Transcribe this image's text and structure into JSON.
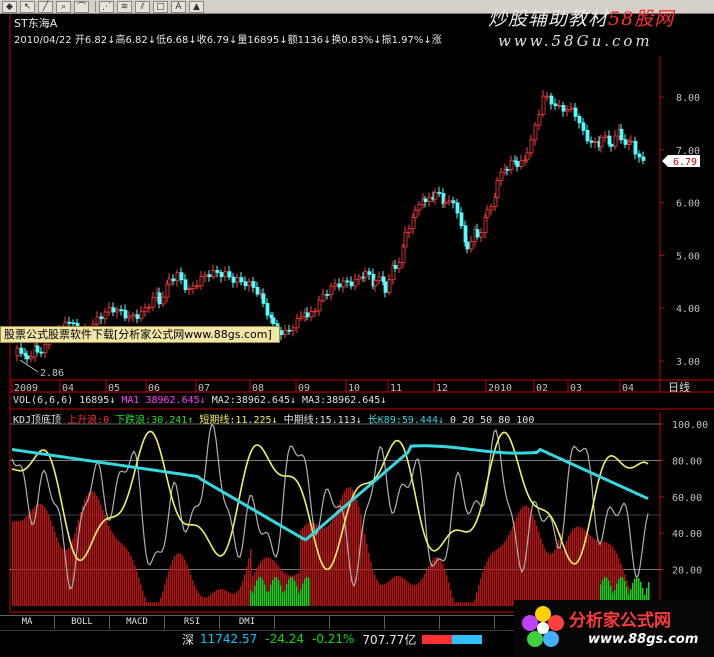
{
  "toolbar": {
    "buttons": [
      "diamond-icon",
      "cursor-icon",
      "line-draw-icon",
      "zoom-icon",
      "trend-icon",
      "pattern-icon",
      "square-icon",
      "text-icon",
      "arrow-up-icon"
    ]
  },
  "stock": {
    "name": "ST东海A",
    "date": "2010/04/22",
    "quote": "开6.82↓高6.82↓低6.68↓收6.79↓量16895↓额1136↓换0.83%↓振1.97%↓涨"
  },
  "watermark": {
    "title": "炒股辅助教材",
    "brand": "58股网",
    "url": "www.58Gu.com"
  },
  "price_chart": {
    "y_ticks": [
      "8.00",
      "7.00",
      "6.00",
      "5.00",
      "4.00",
      "3.00"
    ],
    "current_price": "6.79",
    "low_marker": "2.86",
    "x_labels": [
      "2009",
      "04",
      "05",
      "06",
      "07",
      "08",
      "09",
      "10",
      "11",
      "12",
      "2010",
      "02",
      "03",
      "04"
    ],
    "period": "日线"
  },
  "promo_banner": "股票公式股票软件下载[分析家公式网www.88gs.com]",
  "volume": {
    "label": "VOL(6,6,6) 16895↓",
    "ma1": "MA1 38962.645↓",
    "ma2": "MA2:38962.645↓",
    "ma3": "MA3:38962.645↓"
  },
  "indicator": {
    "name": "KDJ顶底顶",
    "up": "上升浪:0",
    "down": "下跌浪:30.241↑",
    "short": "短期线:11.225↓",
    "mid": "中期线:15.113↓",
    "long": "长K89:59.444↓",
    "levels": "0 20 50 80 100",
    "y_ticks": [
      "100.00",
      "80.00",
      "60.00",
      "40.00",
      "20.00"
    ]
  },
  "bottom_tabs": [
    "MA",
    "BOLL",
    "MACD",
    "RSI",
    "DMI",
    "",
    "",
    "",
    "",
    ""
  ],
  "status": {
    "market": "深",
    "index": "11742.57",
    "change": "-24.24",
    "percent": "-0.21%",
    "amount": "707.77亿"
  },
  "logo": {
    "title": "分析家公式网",
    "url": "www.88gs.com"
  },
  "colors": {
    "rise": "#ff3c3c",
    "fall": "#54ffff",
    "axis_red": "#c00000",
    "cyan_line": "#34d8e0",
    "yellow_line": "#f0f060",
    "gray_line": "#b0b0b0",
    "green_bars": "#20d020",
    "red_bars": "#b01818"
  }
}
